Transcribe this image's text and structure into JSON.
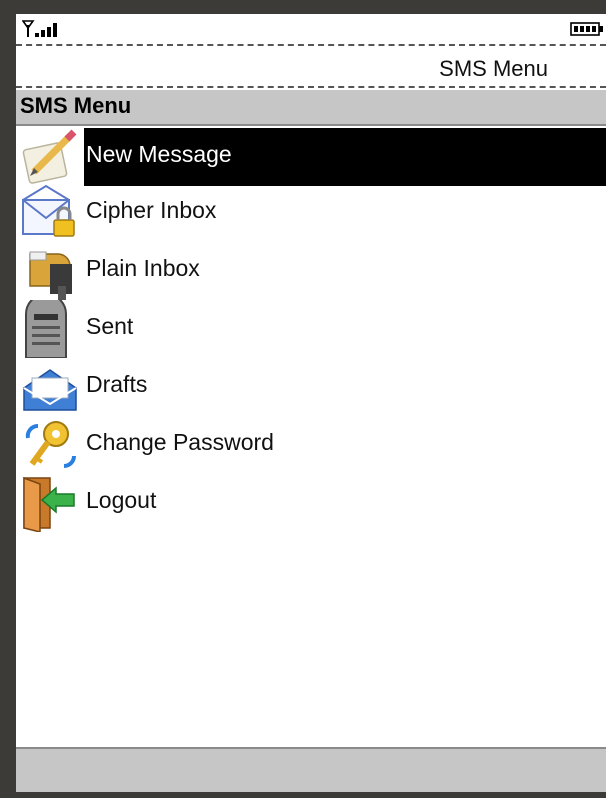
{
  "status": {
    "signal_icon": "signal-strength-icon",
    "battery_icon": "battery-icon"
  },
  "title": "SMS Menu",
  "menu": {
    "header": "SMS Menu",
    "items": [
      {
        "label": "New Message",
        "icon": "pencil-note-icon",
        "selected": true
      },
      {
        "label": "Cipher Inbox",
        "icon": "locked-envelope-icon",
        "selected": false
      },
      {
        "label": "Plain Inbox",
        "icon": "mailbox-icon",
        "selected": false
      },
      {
        "label": "Sent",
        "icon": "mailbox-post-icon",
        "selected": false
      },
      {
        "label": "Drafts",
        "icon": "envelope-icon",
        "selected": false
      },
      {
        "label": "Change Password",
        "icon": "key-icon",
        "selected": false
      },
      {
        "label": "Logout",
        "icon": "exit-door-icon",
        "selected": false
      }
    ]
  },
  "colors": {
    "frame": "#3d3b38",
    "header_bg": "#c6c6c6",
    "selection_bg": "#000000",
    "selection_text": "#ffffff"
  }
}
